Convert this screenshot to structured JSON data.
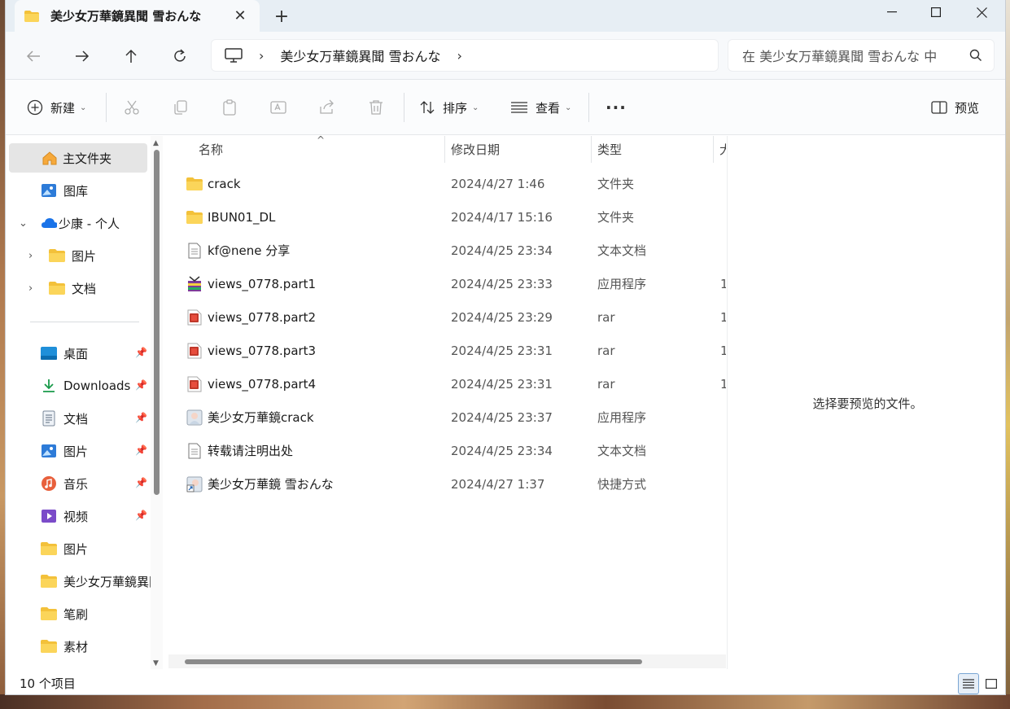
{
  "tab": {
    "title": "美少女万華鏡異聞 雪おんな"
  },
  "address": {
    "path": "美少女万華鏡異聞 雪おんな"
  },
  "search": {
    "placeholder": "在 美少女万華鏡異聞 雪おんな 中"
  },
  "toolbar": {
    "new_label": "新建",
    "sort_label": "排序",
    "view_label": "查看",
    "more_label": "···",
    "preview_label": "预览"
  },
  "sidebar": {
    "home": "主文件夹",
    "gallery": "图库",
    "onedrive": "少康 - 个人",
    "od_pictures": "图片",
    "od_documents": "文档",
    "desktop": "桌面",
    "downloads": "Downloads",
    "documents": "文档",
    "pictures": "图片",
    "music": "音乐",
    "videos": "视频",
    "pictures2": "图片",
    "bishoujo": "美少女万華鏡異聞",
    "brush": "笔刷",
    "material": "素材"
  },
  "columns": {
    "name": "名称",
    "date": "修改日期",
    "type": "类型",
    "size": "大"
  },
  "files": [
    {
      "name": "crack",
      "date": "2024/4/27 1:46",
      "type": "文件夹",
      "size": "",
      "icon": "folder-icon"
    },
    {
      "name": "IBUN01_DL",
      "date": "2024/4/17 15:16",
      "type": "文件夹",
      "size": "",
      "icon": "folder-icon"
    },
    {
      "name": "kf@nene 分享",
      "date": "2024/4/25 23:34",
      "type": "文本文档",
      "size": "",
      "icon": "text-file-icon"
    },
    {
      "name": "views_0778.part1",
      "date": "2024/4/25 23:33",
      "type": "应用程序",
      "size": "1",
      "icon": "winrar-exe-icon"
    },
    {
      "name": "views_0778.part2",
      "date": "2024/4/25 23:29",
      "type": "rar",
      "size": "1",
      "icon": "rar-archive-icon"
    },
    {
      "name": "views_0778.part3",
      "date": "2024/4/25 23:31",
      "type": "rar",
      "size": "1",
      "icon": "rar-archive-icon"
    },
    {
      "name": "views_0778.part4",
      "date": "2024/4/25 23:31",
      "type": "rar",
      "size": "1",
      "icon": "rar-archive-icon"
    },
    {
      "name": "美少女万華鏡crack",
      "date": "2024/4/25 23:37",
      "type": "应用程序",
      "size": "",
      "icon": "app-icon"
    },
    {
      "name": "转载请注明出处",
      "date": "2024/4/25 23:34",
      "type": "文本文档",
      "size": "",
      "icon": "text-file-icon"
    },
    {
      "name": "美少女万華鏡 雪おんな",
      "date": "2024/4/27 1:37",
      "type": "快捷方式",
      "size": "",
      "icon": "shortcut-icon"
    }
  ],
  "preview": {
    "message": "选择要预览的文件。"
  },
  "status": {
    "count": "10 个项目"
  },
  "colors": {
    "folder": "#f7c948",
    "accent": "#0067c0",
    "active_bg": "#e5e5e5"
  }
}
